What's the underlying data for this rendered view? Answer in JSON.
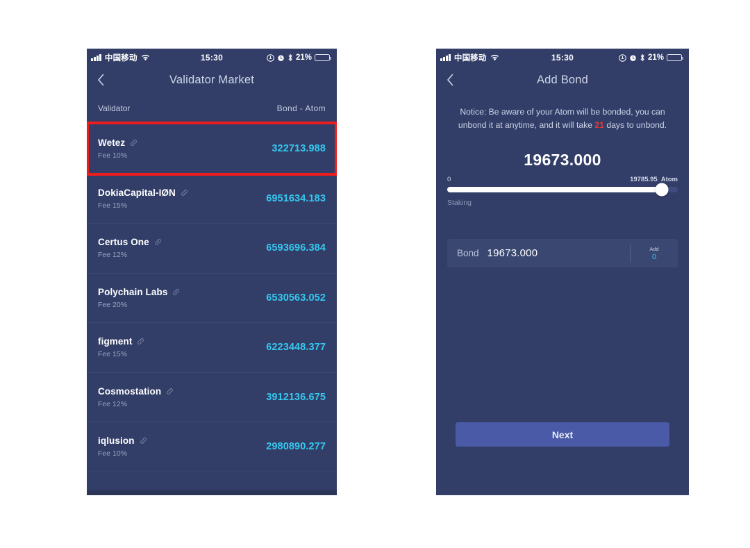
{
  "status_bar": {
    "carrier": "中国移动",
    "time": "15:30",
    "battery_percent": "21%",
    "icons": [
      "signal-bars-icon",
      "wifi-icon",
      "location-icon",
      "alarm-icon",
      "bluetooth-icon",
      "battery-icon"
    ]
  },
  "colors": {
    "screen_bg": "#323e68",
    "row_bg": "#3a4770",
    "accent_cyan": "#35c8ef",
    "highlight_red": "#ee1c1c",
    "notice_red": "#e23a3a",
    "button_blue": "#4a5aa6",
    "track_bg": "#3f4d7e"
  },
  "left_screen": {
    "nav": {
      "back_label": "‹",
      "title": "Validator Market"
    },
    "list_header": {
      "left": "Validator",
      "right": "Bond - Atom"
    },
    "validators": [
      {
        "name": "Wetez",
        "fee": "Fee 10%",
        "bond": "322713.988",
        "selected": true
      },
      {
        "name": "DokiaCapital-IØN",
        "fee": "Fee 15%",
        "bond": "6951634.183",
        "selected": false
      },
      {
        "name": "Certus One",
        "fee": "Fee 12%",
        "bond": "6593696.384",
        "selected": false
      },
      {
        "name": "Polychain Labs",
        "fee": "Fee 20%",
        "bond": "6530563.052",
        "selected": false
      },
      {
        "name": "figment",
        "fee": "Fee 15%",
        "bond": "6223448.377",
        "selected": false
      },
      {
        "name": "Cosmostation",
        "fee": "Fee 12%",
        "bond": "3912136.675",
        "selected": false
      },
      {
        "name": "iqlusion",
        "fee": "Fee 10%",
        "bond": "2980890.277",
        "selected": false
      }
    ]
  },
  "right_screen": {
    "nav": {
      "back_label": "‹",
      "title": "Add Bond"
    },
    "notice": {
      "part1": "Notice: Be aware of your Atom will be bonded, you can unbond it at anytime, and it will take ",
      "days": "21",
      "part2": " days to unbond."
    },
    "amount": "19673.000",
    "slider": {
      "min_label": "0",
      "max_label": "19785.95",
      "unit": "Atom",
      "sub_label": "Staking",
      "value_percent": 93
    },
    "bond_row": {
      "label": "Bond",
      "value": "19673.000",
      "add_label": "Add",
      "add_value": "0"
    },
    "next_label": "Next"
  }
}
